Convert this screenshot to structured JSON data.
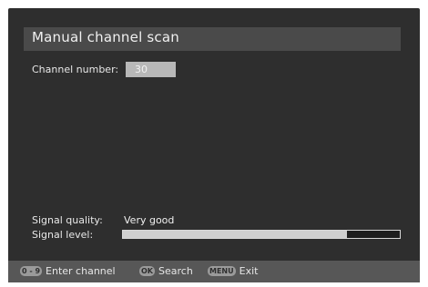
{
  "screen": {
    "title": "Manual channel scan"
  },
  "channel": {
    "label": "Channel number:",
    "value": "30"
  },
  "signal": {
    "quality_label": "Signal quality:",
    "quality_value": "Very good",
    "level_label": "Signal level:",
    "level_fraction": 0.81
  },
  "footer": {
    "hints": [
      {
        "key": "0 - 9",
        "label": "Enter channel"
      },
      {
        "key": "OK",
        "label": "Search"
      },
      {
        "key": "MENU",
        "label": "Exit"
      }
    ]
  },
  "colors": {
    "background": "#2e2e2e",
    "title_bar": "#4a4a4a",
    "input_highlight": "#b8b8b8",
    "footer_bar": "#575757"
  }
}
